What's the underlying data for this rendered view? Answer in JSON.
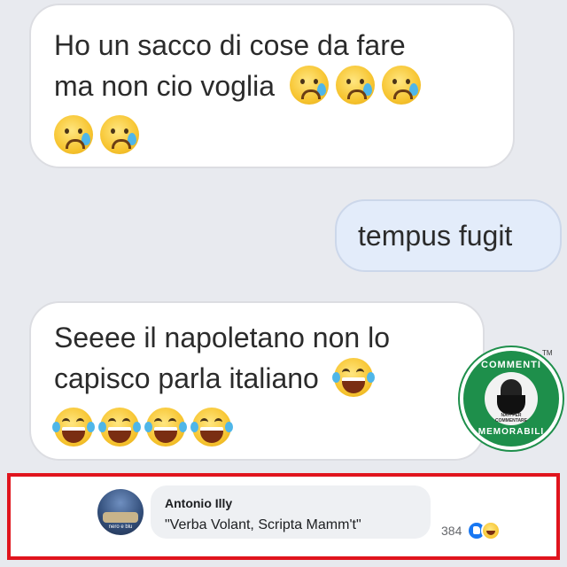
{
  "messages": [
    {
      "direction": "incoming",
      "text_line1": "Ho un sacco di cose da fare",
      "text_line2": "ma non cio voglia",
      "emoji": "crying-face-icon",
      "emoji_count": 5
    },
    {
      "direction": "outgoing",
      "text": "tempus fugit"
    },
    {
      "direction": "incoming",
      "text_line1": "Seeee il napoletano non lo",
      "text_line2": "capisco parla italiano",
      "emoji": "laughing-tears-icon",
      "emoji_count": 5
    }
  ],
  "watermark": {
    "top": "COMMENTI",
    "bottom": "MEMORABILI",
    "small": "NATI PER COMMENTARE",
    "tm": "TM"
  },
  "comment": {
    "author": "Antonio Illy",
    "text": "\"Verba Volant, Scripta Mamm't\"",
    "reaction_count": "384",
    "avatar_caption": "nero e blu",
    "reactions": [
      "like-icon",
      "haha-icon"
    ]
  },
  "colors": {
    "highlight_border": "#e0141d",
    "incoming_bubble": "#ffffff",
    "outgoing_bubble": "#e3ecfa",
    "badge_green": "#1e8f4b",
    "like_blue": "#1877f2"
  }
}
